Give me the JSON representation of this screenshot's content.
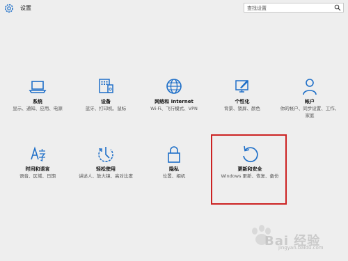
{
  "window": {
    "title": "设置"
  },
  "search": {
    "placeholder": "查找设置"
  },
  "accent_color": "#1e6fc8",
  "highlight_color": "#cc2222",
  "tiles": [
    {
      "label": "系统",
      "desc": "显示、通知、应用、电源",
      "icon": "laptop-icon"
    },
    {
      "label": "设备",
      "desc": "蓝牙、打印机、鼠标",
      "icon": "keyboard-device-icon"
    },
    {
      "label": "网络和 Internet",
      "desc": "Wi-Fi、飞行模式、VPN",
      "icon": "globe-icon"
    },
    {
      "label": "个性化",
      "desc": "背景、锁屏、颜色",
      "icon": "paint-brush-icon"
    },
    {
      "label": "帐户",
      "desc": "你的帐户、同步设置、工作、家庭",
      "icon": "person-icon"
    },
    {
      "label": "时间和语言",
      "desc": "语音、区域、日期",
      "icon": "time-language-icon"
    },
    {
      "label": "轻松使用",
      "desc": "讲述人、放大镜、高对比度",
      "icon": "ease-of-access-icon"
    },
    {
      "label": "隐私",
      "desc": "位置、相机",
      "icon": "lock-icon"
    },
    {
      "label": "更新和安全",
      "desc": "Windows 更新、恢复、备份",
      "icon": "refresh-icon"
    }
  ],
  "watermark": {
    "text": "Bai 经验",
    "sub": "jingyan.baidu.com"
  }
}
